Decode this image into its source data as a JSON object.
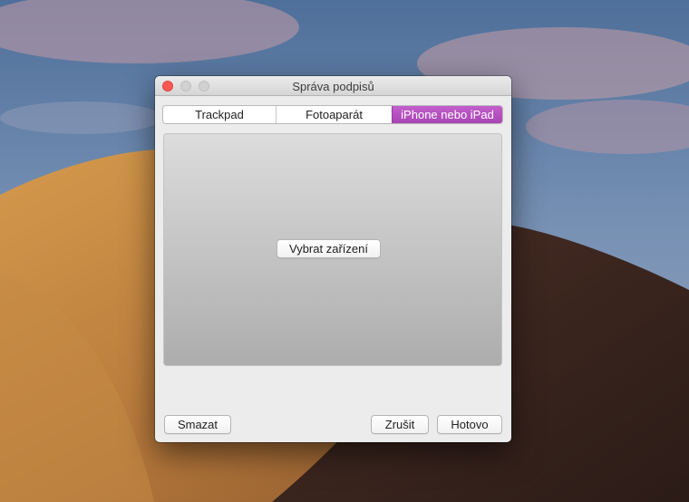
{
  "window": {
    "title": "Správa podpisů"
  },
  "tabs": [
    {
      "label": "Trackpad",
      "active": false
    },
    {
      "label": "Fotoaparát",
      "active": false
    },
    {
      "label": "iPhone nebo iPad",
      "active": true
    }
  ],
  "panel": {
    "select_device_label": "Vybrat zařízení"
  },
  "footer": {
    "delete_label": "Smazat",
    "cancel_label": "Zrušit",
    "done_label": "Hotovo"
  },
  "colors": {
    "active_tab": "#b14fbd",
    "close_button": "#fc5753"
  }
}
